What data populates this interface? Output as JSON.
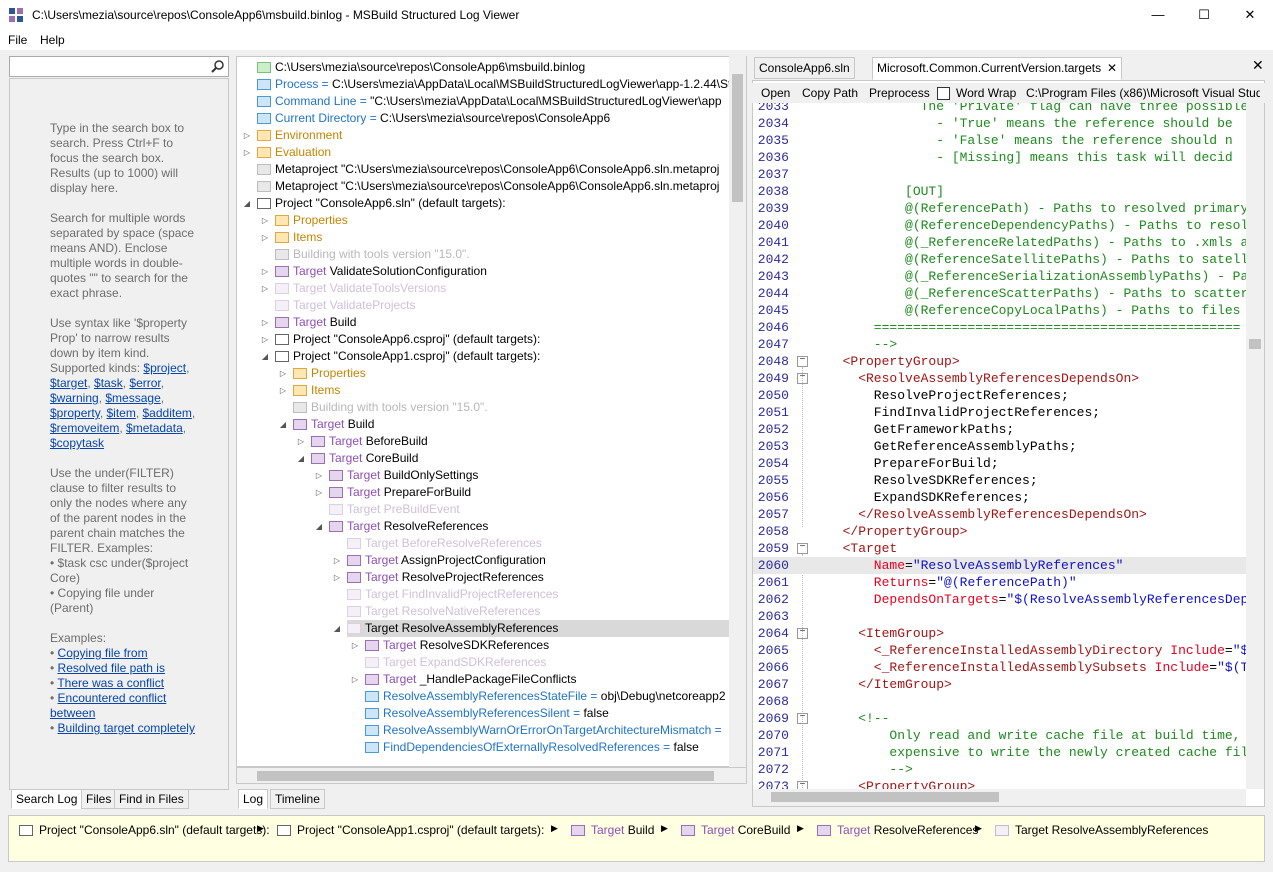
{
  "window": {
    "title": "C:\\Users\\mezia\\source\\repos\\ConsoleApp6\\msbuild.binlog - MSBuild Structured Log Viewer",
    "minimize": "—",
    "maximize": "☐",
    "close": "✕"
  },
  "menu": {
    "file": "File",
    "help": "Help"
  },
  "search": {
    "placeholder": "",
    "value": ""
  },
  "help_text": {
    "p1": "Type in the search box to search. Press Ctrl+F to focus the search box. Results (up to 1000) will display here.",
    "p2": "Search for multiple words separated by space (space means AND). Enclose multiple words in double-quotes \"\" to search for the exact phrase.",
    "p3_intro": "Use syntax like '$property Prop' to narrow results down by item kind. Supported kinds:",
    "kinds": [
      "$project",
      "$target",
      "$task",
      "$error",
      "$warning",
      "$message",
      "$property",
      "$item",
      "$additem",
      "$removeitem",
      "$metadata",
      "$copytask"
    ],
    "p4": "Use the under(FILTER) clause to filter results to only the nodes where any of the parent nodes in the parent chain matches the FILTER. Examples:",
    "ex1": "• $task csc under($project Core)",
    "ex2": "• Copying file under (Parent)",
    "examples_label": "Examples:",
    "examples": [
      "Copying file from",
      "Resolved file path is",
      "There was a conflict",
      "Encountered conflict between",
      "Building target completely"
    ]
  },
  "left_tabs": [
    "Search Log",
    "Files",
    "Find in Files"
  ],
  "tree_tabs": [
    "Log",
    "Timeline"
  ],
  "tree": [
    {
      "indent": 0,
      "exp": "",
      "icon": "green",
      "kw": "",
      "text": "C:\\Users\\mezia\\source\\repos\\ConsoleApp6\\msbuild.binlog",
      "cls": ""
    },
    {
      "indent": 0,
      "exp": "",
      "icon": "blue",
      "kw": "Process = ",
      "text": "C:\\Users\\mezia\\AppData\\Local\\MSBuildStructuredLogViewer\\app-1.2.44\\St",
      "cls": "kw"
    },
    {
      "indent": 0,
      "exp": "",
      "icon": "blue",
      "kw": "Command Line = ",
      "text": "\"C:\\Users\\mezia\\AppData\\Local\\MSBuildStructuredLogViewer\\app",
      "cls": "kw"
    },
    {
      "indent": 0,
      "exp": "",
      "icon": "blue",
      "kw": "Current Directory = ",
      "text": "C:\\Users\\mezia\\source\\repos\\ConsoleApp6",
      "cls": "kw"
    },
    {
      "indent": 0,
      "exp": "▷",
      "icon": "orange",
      "kw": "Environment",
      "text": "",
      "cls": "org"
    },
    {
      "indent": 0,
      "exp": "▷",
      "icon": "orange",
      "kw": "Evaluation",
      "text": "",
      "cls": "org"
    },
    {
      "indent": 0,
      "exp": "",
      "icon": "gray",
      "kw": "",
      "text": "Metaproject \"C:\\Users\\mezia\\source\\repos\\ConsoleApp6\\ConsoleApp6.sln.metaproj",
      "cls": ""
    },
    {
      "indent": 0,
      "exp": "",
      "icon": "gray",
      "kw": "",
      "text": "Metaproject \"C:\\Users\\mezia\\source\\repos\\ConsoleApp6\\ConsoleApp6.sln.metaproj",
      "cls": ""
    },
    {
      "indent": 0,
      "exp": "◢",
      "icon": "proj",
      "kw": "",
      "text": "Project \"ConsoleApp6.sln\" (default targets):",
      "cls": ""
    },
    {
      "indent": 1,
      "exp": "▷",
      "icon": "orange",
      "kw": "Properties",
      "text": "",
      "cls": "org"
    },
    {
      "indent": 1,
      "exp": "▷",
      "icon": "orange",
      "kw": "Items",
      "text": "",
      "cls": "org"
    },
    {
      "indent": 1,
      "exp": "",
      "icon": "gray",
      "kw": "Building with tools version \"15.0\".",
      "text": "",
      "cls": "dim"
    },
    {
      "indent": 1,
      "exp": "▷",
      "icon": "purple",
      "kw": "Target ",
      "text": "ValidateSolutionConfiguration",
      "cls": "kwp"
    },
    {
      "indent": 1,
      "exp": "▷",
      "icon": "lpurple",
      "kw": "Target ValidateToolsVersions",
      "text": "",
      "cls": "dimp"
    },
    {
      "indent": 1,
      "exp": "",
      "icon": "lpurple",
      "kw": "Target ValidateProjects",
      "text": "",
      "cls": "dimp"
    },
    {
      "indent": 1,
      "exp": "▷",
      "icon": "purple",
      "kw": "Target ",
      "text": "Build",
      "cls": "kwp"
    },
    {
      "indent": 1,
      "exp": "▷",
      "icon": "proj",
      "kw": "",
      "text": "Project \"ConsoleApp6.csproj\" (default targets):",
      "cls": ""
    },
    {
      "indent": 1,
      "exp": "◢",
      "icon": "proj",
      "kw": "",
      "text": "Project \"ConsoleApp1.csproj\" (default targets):",
      "cls": ""
    },
    {
      "indent": 2,
      "exp": "▷",
      "icon": "orange",
      "kw": "Properties",
      "text": "",
      "cls": "org"
    },
    {
      "indent": 2,
      "exp": "▷",
      "icon": "orange",
      "kw": "Items",
      "text": "",
      "cls": "org"
    },
    {
      "indent": 2,
      "exp": "",
      "icon": "gray",
      "kw": "Building with tools version \"15.0\".",
      "text": "",
      "cls": "dim"
    },
    {
      "indent": 2,
      "exp": "◢",
      "icon": "purple",
      "kw": "Target ",
      "text": "Build",
      "cls": "kwp"
    },
    {
      "indent": 3,
      "exp": "▷",
      "icon": "purple",
      "kw": "Target ",
      "text": "BeforeBuild",
      "cls": "kwp"
    },
    {
      "indent": 3,
      "exp": "◢",
      "icon": "purple",
      "kw": "Target ",
      "text": "CoreBuild",
      "cls": "kwp"
    },
    {
      "indent": 4,
      "exp": "▷",
      "icon": "purple",
      "kw": "Target ",
      "text": "BuildOnlySettings",
      "cls": "kwp"
    },
    {
      "indent": 4,
      "exp": "▷",
      "icon": "purple",
      "kw": "Target ",
      "text": "PrepareForBuild",
      "cls": "kwp"
    },
    {
      "indent": 4,
      "exp": "",
      "icon": "lpurple",
      "kw": "Target PreBuildEvent",
      "text": "",
      "cls": "dimp"
    },
    {
      "indent": 4,
      "exp": "◢",
      "icon": "purple",
      "kw": "Target ",
      "text": "ResolveReferences",
      "cls": "kwp"
    },
    {
      "indent": 5,
      "exp": "",
      "icon": "lpurple",
      "kw": "Target BeforeResolveReferences",
      "text": "",
      "cls": "dimp"
    },
    {
      "indent": 5,
      "exp": "▷",
      "icon": "purple",
      "kw": "Target ",
      "text": "AssignProjectConfiguration",
      "cls": "kwp"
    },
    {
      "indent": 5,
      "exp": "▷",
      "icon": "purple",
      "kw": "Target ",
      "text": "ResolveProjectReferences",
      "cls": "kwp"
    },
    {
      "indent": 5,
      "exp": "",
      "icon": "lpurple",
      "kw": "Target FindInvalidProjectReferences",
      "text": "",
      "cls": "dimp"
    },
    {
      "indent": 5,
      "exp": "",
      "icon": "lpurple",
      "kw": "Target ResolveNativeReferences",
      "text": "",
      "cls": "dimp"
    },
    {
      "indent": 5,
      "exp": "◢",
      "icon": "lpurple",
      "kw": "",
      "text": "Target ResolveAssemblyReferences",
      "cls": "",
      "sel": true
    },
    {
      "indent": 6,
      "exp": "▷",
      "icon": "purple",
      "kw": "Target ",
      "text": "ResolveSDKReferences",
      "cls": "kwp"
    },
    {
      "indent": 6,
      "exp": "",
      "icon": "lpurple",
      "kw": "Target ExpandSDKReferences",
      "text": "",
      "cls": "dimp"
    },
    {
      "indent": 6,
      "exp": "▷",
      "icon": "purple",
      "kw": "Target ",
      "text": "_HandlePackageFileConflicts",
      "cls": "kwp"
    },
    {
      "indent": 6,
      "exp": "",
      "icon": "blue",
      "kw": "ResolveAssemblyReferencesStateFile = ",
      "text": "obj\\Debug\\netcoreapp2",
      "cls": "kw"
    },
    {
      "indent": 6,
      "exp": "",
      "icon": "blue",
      "kw": "ResolveAssemblyReferencesSilent = ",
      "text": "false",
      "cls": "kw"
    },
    {
      "indent": 6,
      "exp": "",
      "icon": "blue",
      "kw": "ResolveAssemblyWarnOrErrorOnTargetArchitectureMismatch = ",
      "text": "",
      "cls": "kw"
    },
    {
      "indent": 6,
      "exp": "",
      "icon": "blue",
      "kw": "FindDependenciesOfExternallyResolvedReferences = ",
      "text": "false",
      "cls": "kw"
    }
  ],
  "doc_tabs": [
    "ConsoleApp6.sln",
    "Microsoft.Common.CurrentVersion.targets"
  ],
  "doc_tab_close": "✕",
  "doc_toolbar": {
    "open": "Open",
    "copy_path": "Copy Path",
    "preprocess": "Preprocess",
    "word_wrap": "Word Wrap",
    "path": "C:\\Program Files (x86)\\Microsoft Visual Studi"
  },
  "code": [
    {
      "n": "2033",
      "t": "            The 'Private' flag can have three possible",
      "c": "cm"
    },
    {
      "n": "2034",
      "t": "              - 'True' means the reference should be",
      "c": "cm"
    },
    {
      "n": "2035",
      "t": "              - 'False' means the reference should n",
      "c": "cm"
    },
    {
      "n": "2036",
      "t": "              - [Missing] means this task will decid",
      "c": "cm"
    },
    {
      "n": "2037",
      "t": "",
      "c": "cm"
    },
    {
      "n": "2038",
      "t": "          [OUT]",
      "c": "cm"
    },
    {
      "n": "2039",
      "t": "          @(ReferencePath) - Paths to resolved primary f",
      "c": "cm"
    },
    {
      "n": "2040",
      "t": "          @(ReferenceDependencyPaths) - Paths to resolve",
      "c": "cm"
    },
    {
      "n": "2041",
      "t": "          @(_ReferenceRelatedPaths) - Paths to .xmls and",
      "c": "cm"
    },
    {
      "n": "2042",
      "t": "          @(ReferenceSatellitePaths) - Paths to satellit",
      "c": "cm"
    },
    {
      "n": "2043",
      "t": "          @(_ReferenceSerializationAssemblyPaths) - Path",
      "c": "cm"
    },
    {
      "n": "2044",
      "t": "          @(_ReferenceScatterPaths) - Paths to scatter f",
      "c": "cm"
    },
    {
      "n": "2045",
      "t": "          @(ReferenceCopyLocalPaths) - Paths to files th",
      "c": "cm"
    },
    {
      "n": "2046",
      "t": "      ===============================================",
      "c": "cm"
    },
    {
      "n": "2047",
      "t": "      -->",
      "c": "cm"
    },
    {
      "n": "2048",
      "t": "  <PropertyGroup>",
      "c": "tag",
      "fold": "−"
    },
    {
      "n": "2049",
      "t": "    <ResolveAssemblyReferencesDependsOn>",
      "c": "tag",
      "fold": "−"
    },
    {
      "n": "2050",
      "t": "      ResolveProjectReferences;",
      "c": "blk"
    },
    {
      "n": "2051",
      "t": "      FindInvalidProjectReferences;",
      "c": "blk"
    },
    {
      "n": "2052",
      "t": "      GetFrameworkPaths;",
      "c": "blk"
    },
    {
      "n": "2053",
      "t": "      GetReferenceAssemblyPaths;",
      "c": "blk"
    },
    {
      "n": "2054",
      "t": "      PrepareForBuild;",
      "c": "blk"
    },
    {
      "n": "2055",
      "t": "      ResolveSDKReferences;",
      "c": "blk"
    },
    {
      "n": "2056",
      "t": "      ExpandSDKReferences;",
      "c": "blk"
    },
    {
      "n": "2057",
      "t": "    </ResolveAssemblyReferencesDependsOn>",
      "c": "tag"
    },
    {
      "n": "2058",
      "t": "  </PropertyGroup>",
      "c": "tag"
    },
    {
      "n": "2059",
      "t": "  <Target",
      "c": "tag",
      "fold": "−"
    },
    {
      "n": "2060",
      "a": "      Name",
      "v": "\"ResolveAssemblyReferences\"",
      "c": "attr",
      "hl": true
    },
    {
      "n": "2061",
      "a": "      Returns",
      "v": "\"@(ReferencePath)\"",
      "c": "attr"
    },
    {
      "n": "2062",
      "a": "      DependsOnTargets",
      "v": "\"$(ResolveAssemblyReferencesDep",
      "c": "attr"
    },
    {
      "n": "2063",
      "t": "",
      "c": "blk"
    },
    {
      "n": "2064",
      "t": "    <ItemGroup>",
      "c": "tag",
      "fold": "−"
    },
    {
      "n": "2065",
      "t": "      <_ReferenceInstalledAssemblyDirectory Include",
      "v": "\"$",
      "c": "tagattr"
    },
    {
      "n": "2066",
      "t": "      <_ReferenceInstalledAssemblySubsets Include",
      "v": "\"$(T",
      "c": "tagattr"
    },
    {
      "n": "2067",
      "t": "    </ItemGroup>",
      "c": "tag"
    },
    {
      "n": "2068",
      "t": "",
      "c": "blk"
    },
    {
      "n": "2069",
      "t": "    <!--",
      "c": "cm",
      "fold": "−"
    },
    {
      "n": "2070",
      "t": "        Only read and write cache file at build time, s",
      "c": "cm"
    },
    {
      "n": "2071",
      "t": "        expensive to write the newly created cache fil",
      "c": "cm"
    },
    {
      "n": "2072",
      "t": "        -->",
      "c": "cm"
    },
    {
      "n": "2073",
      "t": "    <PropertyGroup>",
      "c": "tag",
      "fold": "−"
    }
  ],
  "breadcrumb": [
    {
      "icon": "proj",
      "kw": "",
      "text": "Project \"ConsoleApp6.sln\" (default targets):"
    },
    {
      "icon": "proj",
      "kw": "",
      "text": "Project \"ConsoleApp1.csproj\" (default targets):"
    },
    {
      "icon": "purple",
      "kw": "Target ",
      "text": "Build"
    },
    {
      "icon": "purple",
      "kw": "Target ",
      "text": "CoreBuild"
    },
    {
      "icon": "purple",
      "kw": "Target ",
      "text": "ResolveReferences"
    },
    {
      "icon": "lpurple",
      "kw": "",
      "text": "Target ResolveAssemblyReferences"
    }
  ],
  "colors": {
    "accent": "#1f73c8",
    "target": "#8e4fb5",
    "tag": "#a31515",
    "comment": "#1e8a1e",
    "attr": "#e8001f",
    "value": "#1010c8",
    "crumb_bg": "#ffffe1"
  }
}
